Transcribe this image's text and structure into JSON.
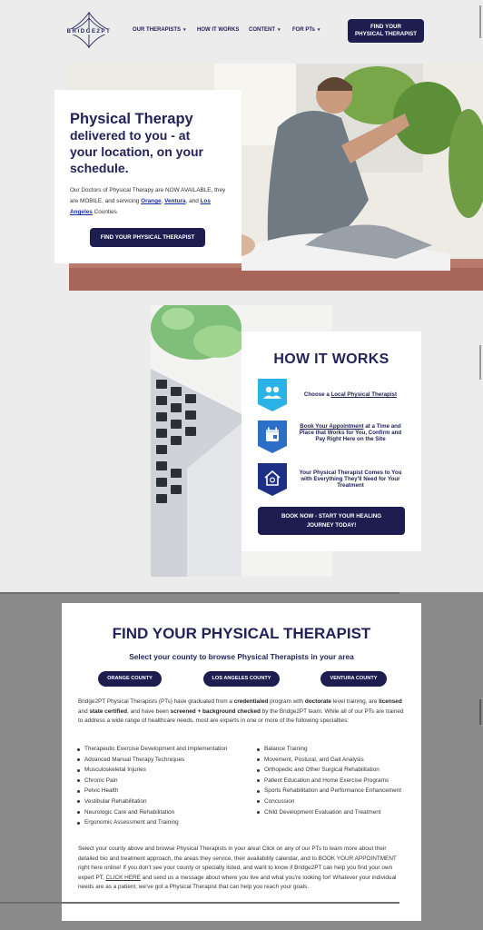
{
  "header": {
    "logo_text": "BRIDGE2PT",
    "nav": [
      {
        "label": "OUR THERAPISTS",
        "dropdown": true
      },
      {
        "label": "HOW IT WORKS",
        "dropdown": false
      },
      {
        "label": "CONTENT",
        "dropdown": true
      },
      {
        "label": "FOR PTs",
        "dropdown": true
      }
    ],
    "cta_line1": "FIND YOUR",
    "cta_line2": "PHYSICAL THERAPIST"
  },
  "hero": {
    "title_line1": "Physical Therapy",
    "title_line2": "delivered  to you - at",
    "title_line3": "your location, on your",
    "title_line4": "schedule.",
    "body_part1": "Our Doctors of Physical Therapy are NOW AVAILABLE, they are MOBILE,  and servicing ",
    "link_orange": "Orange",
    "sep1": ", ",
    "link_ventura": "Ventura",
    "sep2": ", and ",
    "link_la": "Los Angeles",
    "body_part2": " Counties",
    "button": "FIND YOUR PHYSICAL THERAPIST"
  },
  "how_it_works": {
    "title": "HOW IT WORKS",
    "step1_pre": "Choose a ",
    "step1_link": "Local Physical Therapist",
    "step2_link": "Book Your Appointment",
    "step2_rest": " at a Time and Place that Works for You, Confirm and Pay Right Here on the Site",
    "step3": "Your Physical Therapist Comes to You with Everything They'll Need for Your Treatment",
    "button_line1": "BOOK NOW - START YOUR HEALING",
    "button_line2": "JOURNEY TODAY!"
  },
  "find": {
    "title": "FIND YOUR PHYSICAL THERAPIST",
    "subtitle": "Select your county to browse Physical Therapists in your area",
    "county_orange": "ORANGE COUNTY",
    "county_la": "LOS ANGELES COUNTY",
    "county_ventura": "VENTURA COUNTY",
    "p1_a": "Bridge2PT Physical Therapists (PTs) have graduated from a ",
    "p1_b": "credentialed",
    "p1_c": " program with ",
    "p1_d": "doctorate",
    "p1_e": " level training, are ",
    "p1_f": "licensed",
    "p1_g": " and ",
    "p1_h": "state certified",
    "p1_i": ", and have been ",
    "p1_j": "screened + background checked",
    "p1_k": " by the Bridge2PT team. While all of our PTs are trained to address a wide range of healthcare needs, most are experts in one or more of the following specialties:",
    "specialties_left": [
      "Therapeutic Exercise Development and Implementation",
      "Advanced Manual Therapy Techniques",
      "Musculoskeletal Injuries",
      "Chronic Pain",
      "Pelvic Health",
      "Vestibular Rehabilitation",
      "Neurologic Care and Rehabilitation",
      "Ergonomic Assessment and Training"
    ],
    "specialties_right": [
      "Balance Training",
      "Movement, Postural, and Gait Analysis",
      "Orthopedic and Other Surgical Rehabilitation",
      "Patient Education and Home Exercise Programs",
      "Sports Rehabilitation and Performance Enhancement",
      "Concussion",
      "Child Development Evaluation and Treatment"
    ],
    "p2_a": "Select your county above and browse Physical Therapists in your area! Click on any of our PTs to learn more about their detailed bio and treatment approach, the areas they service, their availability calendar, and to BOOK YOUR APPOINTMENT right here online! If you don't see your county or specialty listed, and want to know if Bridge2PT can help you find your own expert PT, ",
    "p2_link": "CLICK HERE",
    "p2_b": " and send us a message about where you live and what you're looking for! Whatever your individual needs are as a patient, we've got a Physical Therapist that can help you reach your goals."
  },
  "colors": {
    "navy": "#1d1d50",
    "title_navy": "#23235a",
    "icon_blue": "#1e2f86",
    "icon_cyan": "#2bb3e8",
    "link_blue": "#1a2fb0"
  }
}
